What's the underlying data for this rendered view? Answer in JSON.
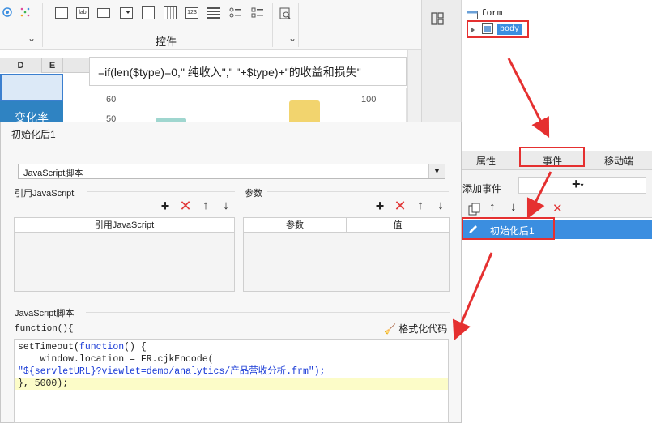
{
  "toolbar": {
    "section_label": "控件",
    "icons": [
      "textfield-icon",
      "label-icon",
      "textarea-icon",
      "combobox-icon",
      "tab-icon",
      "datepicker-icon",
      "number-icon",
      "list-icon",
      "radio-group-icon",
      "checkbox-group-icon",
      "search-icon"
    ],
    "lab_text": "lab",
    "num_text": "123"
  },
  "sheet": {
    "columns": [
      "D",
      "E"
    ],
    "formula": "=if(len($type)=0,\"  纯收入\",\"  \"+$type)+\"的收益和损失\"",
    "cell_text": "变化率",
    "ticks_left": [
      "60",
      "50"
    ],
    "ticks_right": [
      "100"
    ]
  },
  "dialog": {
    "title": "初始化后1",
    "select_value": "JavaScript脚本",
    "ref_js_label": "引用JavaScript",
    "params_label": "参数",
    "ref_js_header": "引用JavaScript",
    "params_headers": [
      "参数",
      "值"
    ],
    "js_script_label": "JavaScript脚本",
    "func_label": "function(){",
    "format_label": "格式化代码",
    "code_lines": [
      "setTimeout(function() {",
      "    window.location = FR.cjkEncode(",
      "\"${servletURL}?viewlet=demo/analytics/产品营收分析.frm\");",
      "}, 5000);"
    ]
  },
  "right_panel": {
    "tree_form": "form",
    "tree_body": "body",
    "tabs": [
      "属性",
      "事件",
      "移动端"
    ],
    "add_event_label": "添加事件",
    "event_item": "初始化后1"
  },
  "colors": {
    "accent_blue": "#3b8ee0",
    "highlight_red": "#e53030",
    "delete_red": "#e23a3a",
    "cell_blue": "#2f83c2"
  }
}
